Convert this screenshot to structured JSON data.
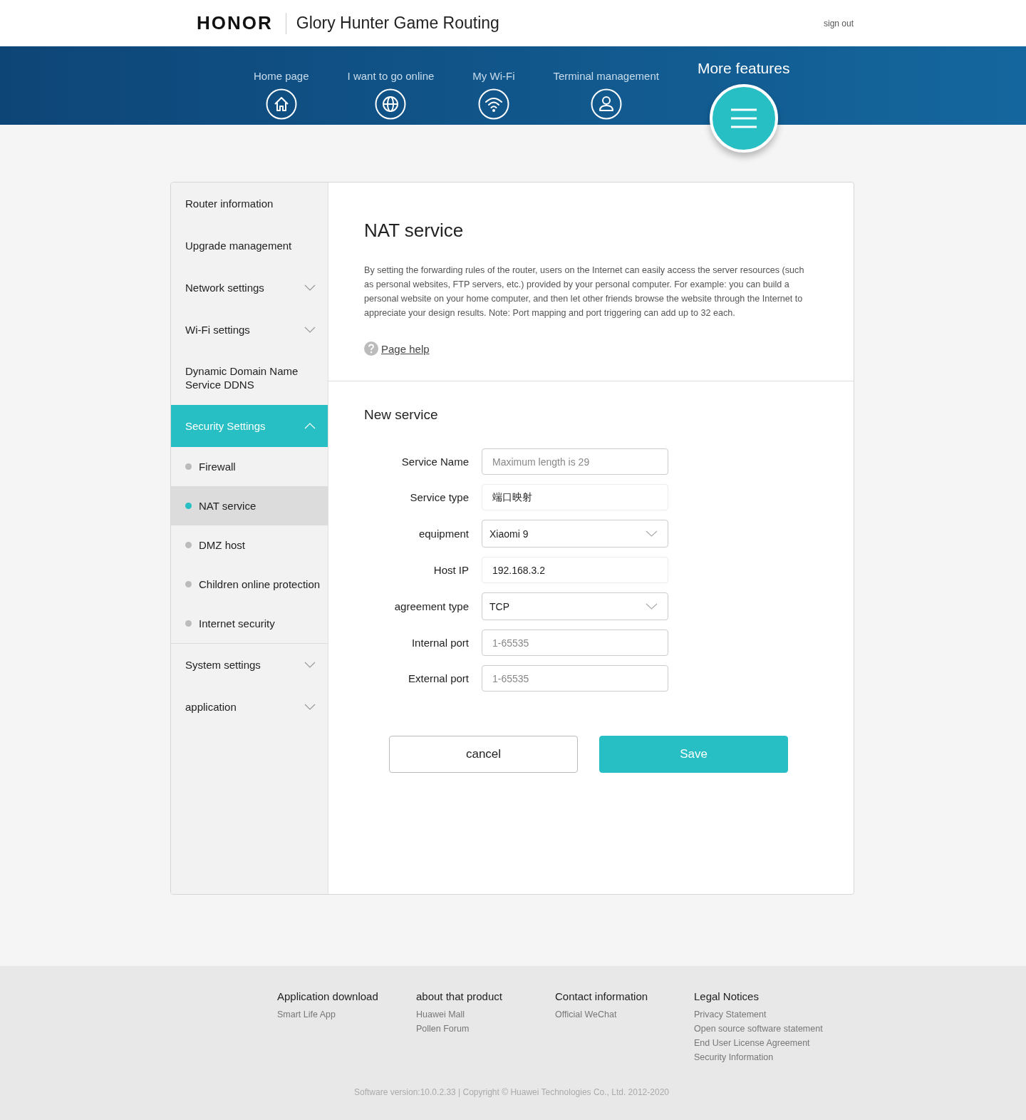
{
  "header": {
    "logo": "HONOR",
    "title": "Glory Hunter Game Routing",
    "sign_out": "sign out"
  },
  "nav": [
    {
      "label": "Home page",
      "kind": "home",
      "selected": false
    },
    {
      "label": "I want to go online",
      "kind": "globe",
      "selected": false
    },
    {
      "label": "My Wi-Fi",
      "kind": "wifi",
      "selected": false
    },
    {
      "label": "Terminal management",
      "kind": "person",
      "selected": false
    },
    {
      "label": "More features",
      "kind": "menu",
      "selected": true
    }
  ],
  "sidebar": [
    {
      "label": "Router information",
      "kind": "link"
    },
    {
      "label": "Upgrade management",
      "kind": "link"
    },
    {
      "label": "Network settings",
      "kind": "group",
      "expanded": false
    },
    {
      "label": "Wi-Fi settings",
      "kind": "group",
      "expanded": false
    },
    {
      "label": "Dynamic Domain Name Service DDNS",
      "kind": "link"
    },
    {
      "label": "Security Settings",
      "kind": "group",
      "expanded": true,
      "children": [
        {
          "label": "Firewall",
          "selected": false
        },
        {
          "label": "NAT service",
          "selected": true
        },
        {
          "label": "DMZ host",
          "selected": false
        },
        {
          "label": "Children online protection",
          "selected": false
        },
        {
          "label": "Internet security",
          "selected": false
        }
      ]
    },
    {
      "label": "System settings",
      "kind": "group",
      "expanded": false
    },
    {
      "label": "application",
      "kind": "group",
      "expanded": false
    }
  ],
  "page": {
    "title": "NAT service",
    "description": "By setting the forwarding rules of the router, users on the Internet can easily access the server resources (such as personal websites, FTP servers, etc.) provided by your personal computer. For example: you can build a personal website on your home computer, and then let other friends browse the website through the Internet to appreciate your design results. Note: Port mapping and port triggering can add up to 32 each.",
    "help": "Page help"
  },
  "form": {
    "title": "New service",
    "fields": [
      {
        "label": "Service Name",
        "kind": "input",
        "placeholder": "Maximum length is 29"
      },
      {
        "label": "Service type",
        "kind": "readonly",
        "value": "端口映射"
      },
      {
        "label": "equipment",
        "kind": "select",
        "value": "Xiaomi 9"
      },
      {
        "label": "Host IP",
        "kind": "readonly",
        "value": "192.168.3.2"
      },
      {
        "label": "agreement type",
        "kind": "select",
        "value": "TCP"
      },
      {
        "label": "Internal port",
        "kind": "input",
        "placeholder": "1-65535"
      },
      {
        "label": "External port",
        "kind": "input",
        "placeholder": "1-65535"
      }
    ]
  },
  "buttons": [
    {
      "label": "cancel",
      "kind": "secondary"
    },
    {
      "label": "Save",
      "kind": "primary"
    }
  ],
  "footer": {
    "columns": [
      {
        "title": "Application download",
        "links": [
          "Smart Life App"
        ]
      },
      {
        "title": "about that product",
        "links": [
          "Huawei Mall",
          "Pollen Forum"
        ]
      },
      {
        "title": "Contact information",
        "links": [
          "Official WeChat"
        ]
      },
      {
        "title": "Legal Notices",
        "links": [
          "Privacy Statement",
          "Open source software statement",
          "End User License Agreement",
          "Security Information"
        ]
      }
    ],
    "copyright": "Software version:10.0.2.33 | Copyright © Huawei Technologies Co., Ltd. 2012-2020"
  }
}
